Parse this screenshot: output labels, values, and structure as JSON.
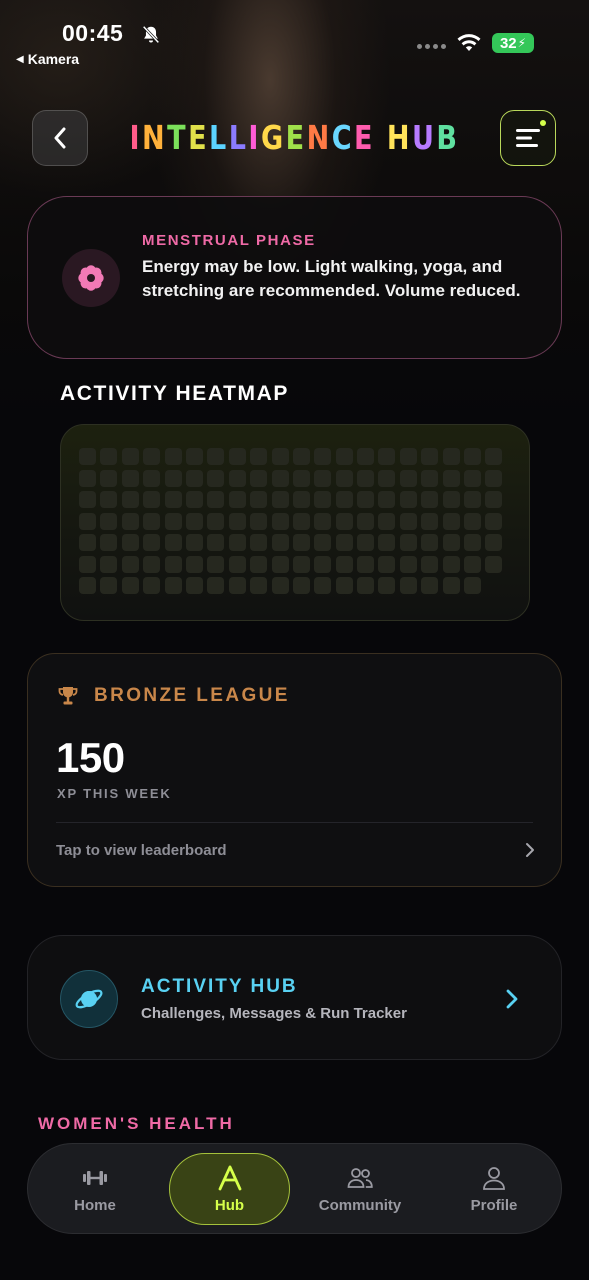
{
  "status_bar": {
    "time": "00:45",
    "back_app": "Kamera",
    "battery": "32"
  },
  "header": {
    "title": "INTELLIGENCE HUB",
    "title_colors": [
      "#ff5c8a",
      "#ffb13b",
      "#7be05a",
      "#e0e04a",
      "#5bd3ff",
      "#8b7bff",
      "#ff5cd6",
      "#ffd84a",
      "#a0e04a",
      "#ff7a45",
      "#6ad7ff",
      "#ff5cae",
      "#ffe35a",
      "#b77bff",
      "#5fe0a0",
      "#ffb84a"
    ]
  },
  "phase": {
    "label": "MENSTRUAL PHASE",
    "text": "Energy may be low. Light walking, yoga, and stretching are recommended. Volume reduced.",
    "icon": "flower-icon"
  },
  "heatmap": {
    "title": "ACTIVITY HEATMAP",
    "columns": 20,
    "rows": 7,
    "last_row_count": 19
  },
  "league": {
    "title": "BRONZE LEAGUE",
    "xp": "150",
    "xp_label": "XP THIS WEEK",
    "leaderboard_text": "Tap to view leaderboard",
    "accent": "#c9874a"
  },
  "activity_hub": {
    "title": "ACTIVITY HUB",
    "subtitle": "Challenges, Messages & Run Tracker",
    "accent": "#59d1f2"
  },
  "womens_health": {
    "title": "WOMEN'S HEALTH"
  },
  "nav": {
    "home": "Home",
    "hub": "Hub",
    "community": "Community",
    "profile": "Profile",
    "active": "Hub"
  }
}
